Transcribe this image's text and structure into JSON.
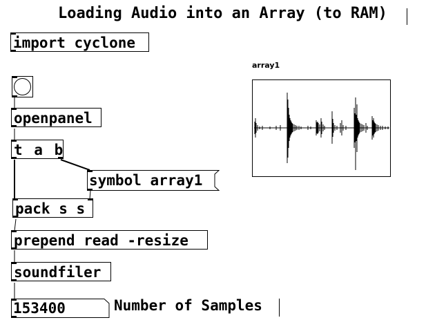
{
  "title": "Loading Audio into an Array (to RAM)",
  "objects": {
    "import": "import cyclone",
    "openpanel": "openpanel",
    "trigger": "t a b",
    "pack": "pack s s",
    "prepend": "prepend read -resize",
    "soundfiler": "soundfiler"
  },
  "messages": {
    "symbol": "symbol array1"
  },
  "array": {
    "name": "array1"
  },
  "number_box": {
    "value": "153400"
  },
  "comments": {
    "samples": "Number of Samples"
  }
}
